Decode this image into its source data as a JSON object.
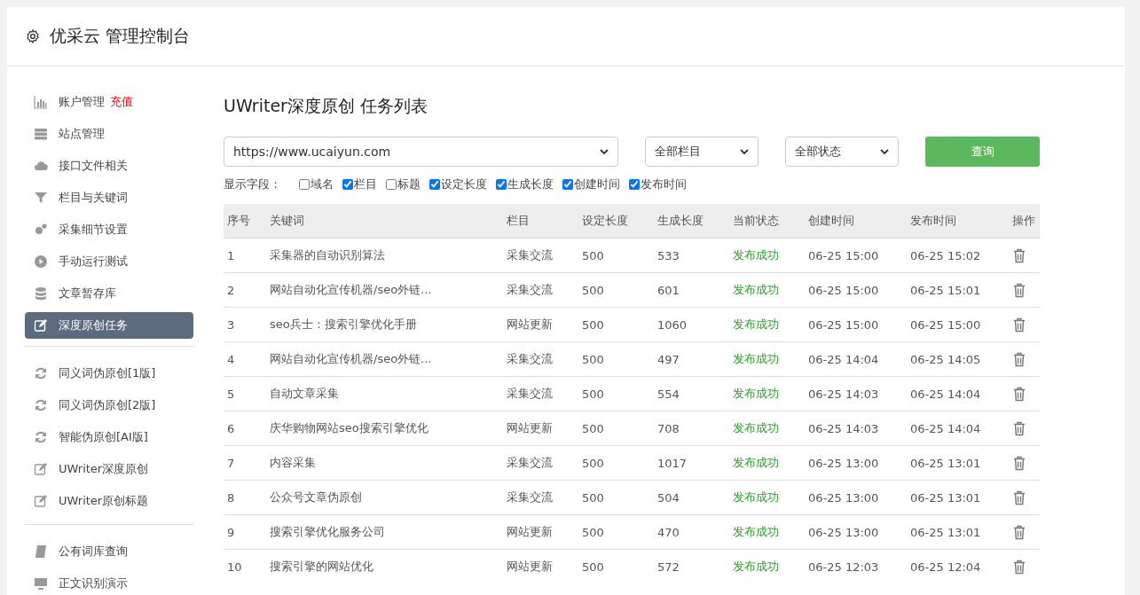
{
  "header": {
    "title": "优采云 管理控制台"
  },
  "sidebar": {
    "groups": [
      {
        "items": [
          {
            "label": "账户管理",
            "badge": "充值",
            "selected": false
          },
          {
            "label": "站点管理",
            "selected": false
          },
          {
            "label": "接口文件相关",
            "selected": false
          },
          {
            "label": "栏目与关键词",
            "selected": false
          },
          {
            "label": "采集细节设置",
            "selected": false
          },
          {
            "label": "手动运行测试",
            "selected": false
          },
          {
            "label": "文章暂存库",
            "selected": false
          },
          {
            "label": "深度原创任务",
            "selected": true
          }
        ]
      },
      {
        "items": [
          {
            "label": "同义词伪原创[1版]",
            "selected": false
          },
          {
            "label": "同义词伪原创[2版]",
            "selected": false
          },
          {
            "label": "智能伪原创[AI版]",
            "selected": false
          },
          {
            "label": "UWriter深度原创",
            "selected": false
          },
          {
            "label": "UWriter原创标题",
            "selected": false
          }
        ]
      },
      {
        "items": [
          {
            "label": "公有词库查询",
            "selected": false
          },
          {
            "label": "正文识别演示",
            "selected": false
          }
        ]
      }
    ]
  },
  "main": {
    "title": "UWriter深度原创 任务列表",
    "filters": {
      "site": "https://www.ucaiyun.com",
      "column": "全部栏目",
      "status": "全部状态",
      "query_button": "查询"
    },
    "fields_label": "显示字段：",
    "fields": [
      {
        "label": "域名",
        "checked": false
      },
      {
        "label": "栏目",
        "checked": true
      },
      {
        "label": "标题",
        "checked": false
      },
      {
        "label": "设定长度",
        "checked": true
      },
      {
        "label": "生成长度",
        "checked": true
      },
      {
        "label": "创建时间",
        "checked": true
      },
      {
        "label": "发布时间",
        "checked": true
      }
    ],
    "table": {
      "columns": [
        "序号",
        "关键词",
        "栏目",
        "设定长度",
        "生成长度",
        "当前状态",
        "创建时间",
        "发布时间",
        "操作"
      ],
      "rows": [
        {
          "no": "1",
          "keyword": "采集器的自动识别算法",
          "column": "采集交流",
          "set_length": "500",
          "gen_length": "533",
          "status": "发布成功",
          "created": "06-25 15:00",
          "published": "06-25 15:02"
        },
        {
          "no": "2",
          "keyword": "网站自动化宣传机器/seo外链...",
          "column": "采集交流",
          "set_length": "500",
          "gen_length": "601",
          "status": "发布成功",
          "created": "06-25 15:00",
          "published": "06-25 15:01"
        },
        {
          "no": "3",
          "keyword": "seo兵士：搜索引擎优化手册",
          "column": "网站更新",
          "set_length": "500",
          "gen_length": "1060",
          "status": "发布成功",
          "created": "06-25 15:00",
          "published": "06-25 15:00"
        },
        {
          "no": "4",
          "keyword": "网站自动化宣传机器/seo外链...",
          "column": "采集交流",
          "set_length": "500",
          "gen_length": "497",
          "status": "发布成功",
          "created": "06-25 14:04",
          "published": "06-25 14:05"
        },
        {
          "no": "5",
          "keyword": "自动文章采集",
          "column": "采集交流",
          "set_length": "500",
          "gen_length": "554",
          "status": "发布成功",
          "created": "06-25 14:03",
          "published": "06-25 14:04"
        },
        {
          "no": "6",
          "keyword": "庆华购物网站seo搜索引擎优化",
          "column": "网站更新",
          "set_length": "500",
          "gen_length": "708",
          "status": "发布成功",
          "created": "06-25 14:03",
          "published": "06-25 14:04"
        },
        {
          "no": "7",
          "keyword": "内容采集",
          "column": "采集交流",
          "set_length": "500",
          "gen_length": "1017",
          "status": "发布成功",
          "created": "06-25 13:00",
          "published": "06-25 13:01"
        },
        {
          "no": "8",
          "keyword": "公众号文章伪原创",
          "column": "采集交流",
          "set_length": "500",
          "gen_length": "504",
          "status": "发布成功",
          "created": "06-25 13:00",
          "published": "06-25 13:01"
        },
        {
          "no": "9",
          "keyword": "搜索引擎优化服务公司",
          "column": "网站更新",
          "set_length": "500",
          "gen_length": "470",
          "status": "发布成功",
          "created": "06-25 13:00",
          "published": "06-25 13:01"
        },
        {
          "no": "10",
          "keyword": "搜索引擎的网站优化",
          "column": "网站更新",
          "set_length": "500",
          "gen_length": "572",
          "status": "发布成功",
          "created": "06-25 12:03",
          "published": "06-25 12:04"
        }
      ]
    }
  }
}
